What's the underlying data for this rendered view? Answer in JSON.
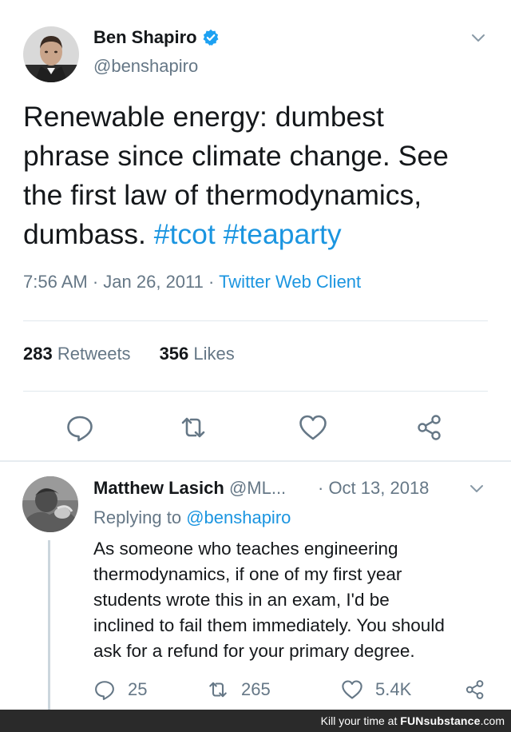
{
  "colors": {
    "text": "#14171a",
    "secondary": "#657786",
    "link": "#1b95e0",
    "divider": "#e1e8ed",
    "verified": "#1da1f2"
  },
  "main_tweet": {
    "author_name": "Ben Shapiro",
    "author_handle": "@benshapiro",
    "verified": true,
    "text_parts": {
      "line1": "Renewable energy: dumbest",
      "line2": "phrase since climate change. See",
      "line3": "the first law of thermodynamics,",
      "line4_prefix": "dumbass. ",
      "hashtag1": "#tcot",
      "hashtag2": "#teaparty"
    },
    "time": "7:56 AM",
    "date": "Jan 26, 2011",
    "separator": "·",
    "client": "Twitter Web Client",
    "retweets_count": "283",
    "retweets_label": "Retweets",
    "likes_count": "356",
    "likes_label": "Likes",
    "icons": [
      "reply-icon",
      "retweet-icon",
      "like-icon",
      "share-icon",
      "chevron-down-icon"
    ]
  },
  "reply_tweet": {
    "author_name": "Matthew Lasich",
    "author_handle": "@ML...",
    "date": "· Oct 13, 2018",
    "replying_prefix": "Replying to ",
    "replying_to": "@benshapiro",
    "text_lines": [
      "As someone who teaches engineering",
      "thermodynamics, if one of my first year",
      "students wrote this in an exam, I'd be",
      "inclined to fail them immediately. You should",
      "ask for a refund for your primary degree."
    ],
    "reply_count": "25",
    "retweet_count": "265",
    "like_count": "5.4K"
  },
  "footer": {
    "prefix": "Kill your time at ",
    "brand": "FUNsubstance",
    "suffix": ".com"
  }
}
